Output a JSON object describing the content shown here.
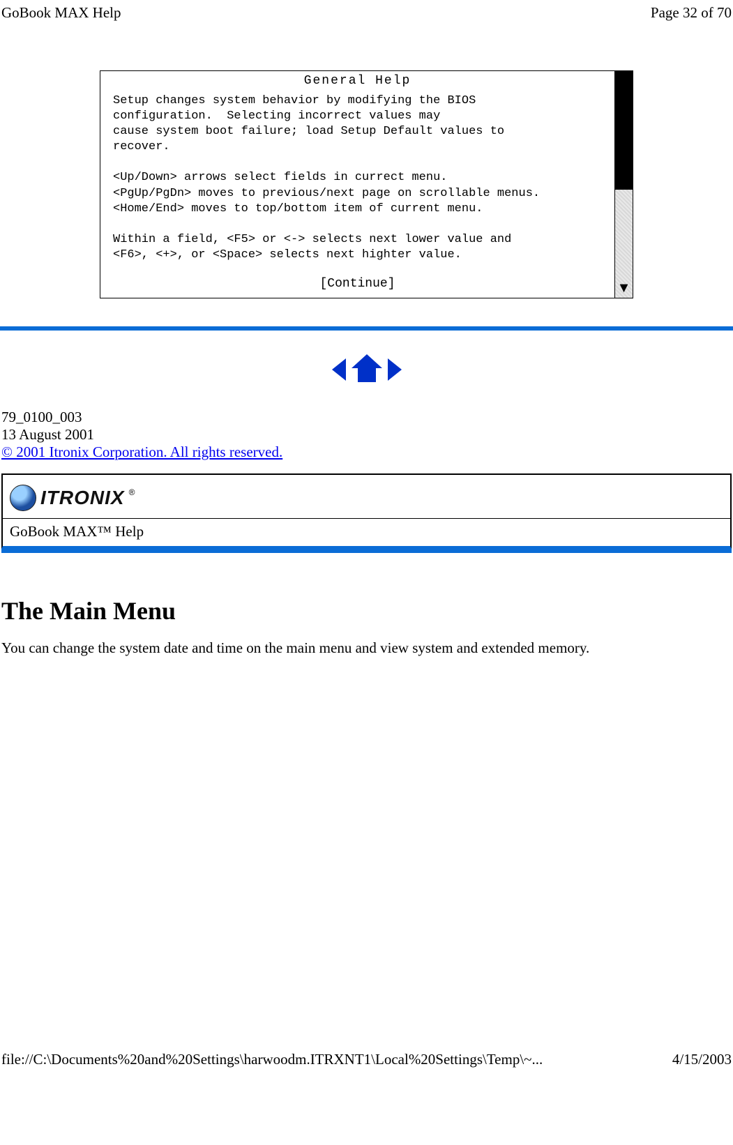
{
  "header": {
    "left": "GoBook MAX Help",
    "right": "Page 32 of 70"
  },
  "bios": {
    "title": "General Help",
    "text": "Setup changes system behavior by modifying the BIOS\nconfiguration.  Selecting incorrect values may\ncause system boot failure; load Setup Default values to\nrecover.\n\n<Up/Down> arrows select fields in currect menu.\n<PgUp/PgDn> moves to previous/next page on scrollable menus.\n<Home/End> moves to top/bottom item of current menu.\n\nWithin a field, <F5> or <-> selects next lower value and\n<F6>, <+>, or <Space> selects next highter value.",
    "continue": "[Continue]"
  },
  "meta": {
    "doc_id": "79_0100_003",
    "date": "13 August 2001",
    "copyright": "© 2001 Itronix Corporation.  All rights reserved."
  },
  "brand": {
    "name": "ITRONIX",
    "subtitle": "GoBook MAX™ Help"
  },
  "section": {
    "title": "The Main Menu",
    "body": "You can change the system date and time on the main menu and view system and extended memory."
  },
  "footer": {
    "path": "file://C:\\Documents%20and%20Settings\\harwoodm.ITRXNT1\\Local%20Settings\\Temp\\~...",
    "date": "4/15/2003"
  }
}
